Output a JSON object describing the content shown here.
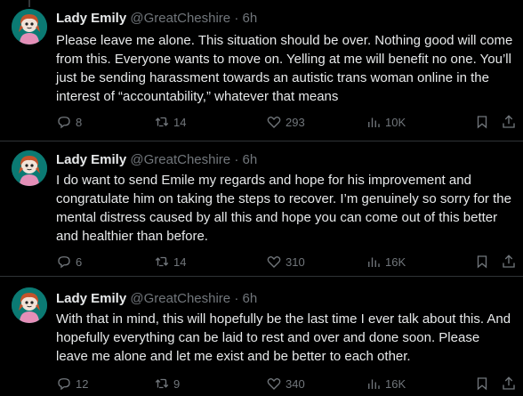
{
  "tweets": [
    {
      "author_name": "Lady Emily",
      "handle": "@GreatCheshire",
      "separator": "·",
      "time": "6h",
      "text": "Please leave me alone. This situation should be over. Nothing good will come from this. Everyone wants to move on. Yelling at me will benefit no one. You’ll just be sending harassment towards an autistic trans woman online in the interest of “accountability,” whatever that means",
      "replies": "8",
      "retweets": "14",
      "likes": "293",
      "views": "10K"
    },
    {
      "author_name": "Lady Emily",
      "handle": "@GreatCheshire",
      "separator": "·",
      "time": "6h",
      "text": "I do want to send Emile my regards and hope for his improvement and congratulate him on taking the steps to recover. I’m genuinely so sorry for the mental distress caused by all this and hope you can come out of this better and healthier than before.",
      "replies": "6",
      "retweets": "14",
      "likes": "310",
      "views": "16K"
    },
    {
      "author_name": "Lady Emily",
      "handle": "@GreatCheshire",
      "separator": "·",
      "time": "6h",
      "text": "With that in mind, this will hopefully be the last time I ever talk about this. And hopefully everything can be laid to rest and over and done soon. Please leave me alone and let me exist and be better to each other.",
      "replies": "12",
      "retweets": "9",
      "likes": "340",
      "views": "16K"
    }
  ],
  "icons": {
    "reply": "reply-icon",
    "retweet": "retweet-icon",
    "like": "heart-icon",
    "views": "views-icon",
    "bookmark": "bookmark-icon",
    "share": "share-icon"
  },
  "colors": {
    "background": "#000000",
    "text": "#e7e9ea",
    "secondary": "#71767b",
    "divider": "#2f3336"
  }
}
